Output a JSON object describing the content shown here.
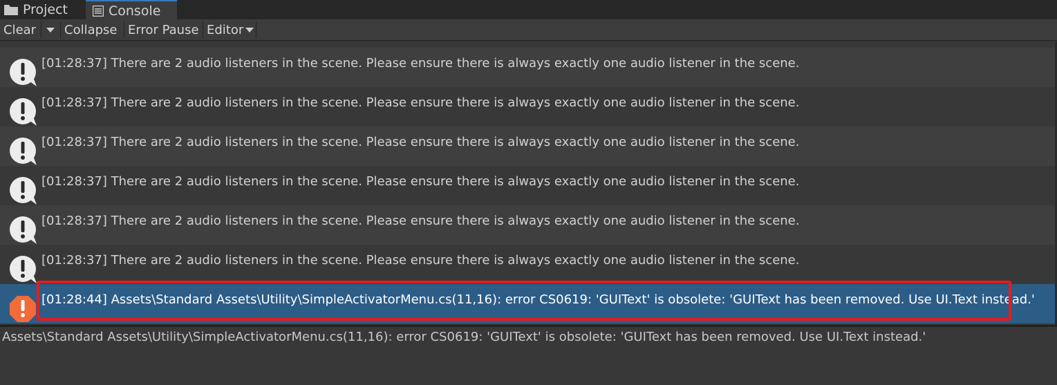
{
  "tabs": [
    {
      "label": "Project",
      "icon": "folder-icon"
    },
    {
      "label": "Console",
      "icon": "console-icon",
      "active": true
    }
  ],
  "toolbar": {
    "clear_label": "Clear",
    "collapse_label": "Collapse",
    "error_pause_label": "Error Pause",
    "editor_label": "Editor"
  },
  "logs": [
    {
      "type": "warning",
      "message": "[01:28:37] There are 2 audio listeners in the scene. Please ensure there is always exactly one audio listener in the scene."
    },
    {
      "type": "warning",
      "message": "[01:28:37] There are 2 audio listeners in the scene. Please ensure there is always exactly one audio listener in the scene."
    },
    {
      "type": "warning",
      "message": "[01:28:37] There are 2 audio listeners in the scene. Please ensure there is always exactly one audio listener in the scene."
    },
    {
      "type": "warning",
      "message": "[01:28:37] There are 2 audio listeners in the scene. Please ensure there is always exactly one audio listener in the scene."
    },
    {
      "type": "warning",
      "message": "[01:28:37] There are 2 audio listeners in the scene. Please ensure there is always exactly one audio listener in the scene."
    },
    {
      "type": "warning",
      "message": "[01:28:37] There are 2 audio listeners in the scene. Please ensure there is always exactly one audio listener in the scene."
    },
    {
      "type": "error",
      "selected": true,
      "message": "[01:28:44] Assets\\Standard Assets\\Utility\\SimpleActivatorMenu.cs(11,16): error CS0619: 'GUIText' is obsolete: 'GUIText has been removed. Use UI.Text instead.'"
    }
  ],
  "detail": {
    "text": "Assets\\Standard Assets\\Utility\\SimpleActivatorMenu.cs(11,16): error CS0619: 'GUIText' is obsolete: 'GUIText has been removed. Use UI.Text instead.'"
  },
  "colors": {
    "selection": "#2c5d87",
    "error_icon": "#f26b3a",
    "highlight_box": "#e41d1d",
    "active_tab_accent": "#3a79bb"
  }
}
